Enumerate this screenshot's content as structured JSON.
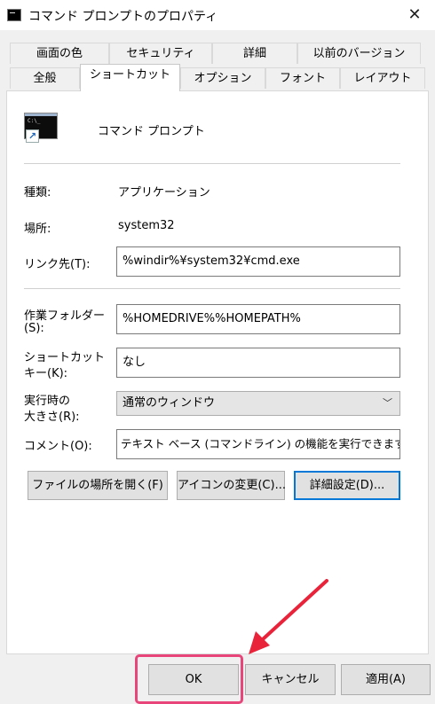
{
  "window": {
    "title": "コマンド プロンプトのプロパティ",
    "close_glyph": "✕"
  },
  "tabs_row1": [
    "画面の色",
    "セキュリティ",
    "詳細",
    "以前のバージョン"
  ],
  "tabs_row2": [
    "全般",
    "ショートカット",
    "オプション",
    "フォント",
    "レイアウト"
  ],
  "active_tab": "ショートカット",
  "shortcut": {
    "name": "コマンド プロンプト",
    "icon": "cmd-console-icon",
    "icon_prompt": "C:\\_",
    "shortcut_overlay_glyph": "↗",
    "type_label": "種類:",
    "type_value": "アプリケーション",
    "location_label": "場所:",
    "location_value": "system32",
    "target_label": "リンク先(T):",
    "target_value": "%windir%¥system32¥cmd.exe",
    "start_in_label_line1": "作業フォルダー",
    "start_in_label_line2": "(S):",
    "start_in_value": "%HOMEDRIVE%%HOMEPATH%",
    "hotkey_label_line1": "ショートカット",
    "hotkey_label_line2": "キー(K):",
    "hotkey_value": "なし",
    "run_label_line1": "実行時の",
    "run_label_line2": "大きさ(R):",
    "run_value": "通常のウィンドウ",
    "run_options": [
      "通常のウィンドウ"
    ],
    "comment_label": "コメント(O):",
    "comment_value": "テキスト ベース (コマンドライン) の機能を実行できます。"
  },
  "buttons": {
    "open_location": "ファイルの場所を開く(F)",
    "change_icon": "アイコンの変更(C)...",
    "advanced": "詳細設定(D)...",
    "ok": "OK",
    "cancel": "キャンセル",
    "apply": "適用(A)"
  },
  "colors": {
    "highlight": "#e8457a",
    "arrow": "#e8233a",
    "default_button_border": "#0078d7"
  }
}
